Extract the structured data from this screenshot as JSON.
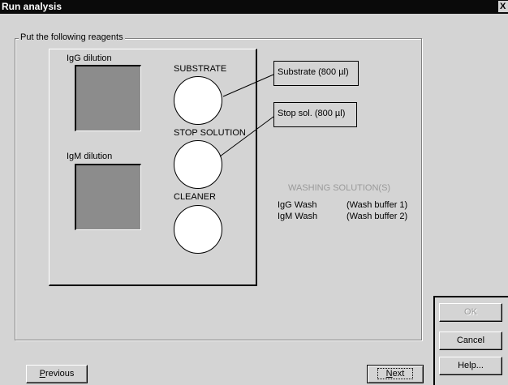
{
  "window": {
    "title": "Run analysis",
    "close_glyph": "X"
  },
  "group": {
    "legend": "Put the following reagents"
  },
  "dilutions": {
    "igg_label": "IgG dilution",
    "igm_label": "IgM dilution"
  },
  "bottles": {
    "substrate_label": "SUBSTRATE",
    "stop_label": "STOP SOLUTION",
    "cleaner_label": "CLEANER"
  },
  "callouts": {
    "substrate": "Substrate (800 µl)",
    "stop": "Stop sol. (800 µl)"
  },
  "washing": {
    "title": "WASHING SOLUTION(S)",
    "rows": [
      {
        "name": "IgG Wash",
        "buffer": "(Wash buffer 1)"
      },
      {
        "name": "IgM Wash",
        "buffer": "(Wash buffer 2)"
      }
    ]
  },
  "buttons": {
    "previous_prefix": "P",
    "previous_rest": "revious",
    "next_prefix": "N",
    "next_rest": "ext",
    "ok": "OK",
    "cancel": "Cancel",
    "help": "Help..."
  }
}
